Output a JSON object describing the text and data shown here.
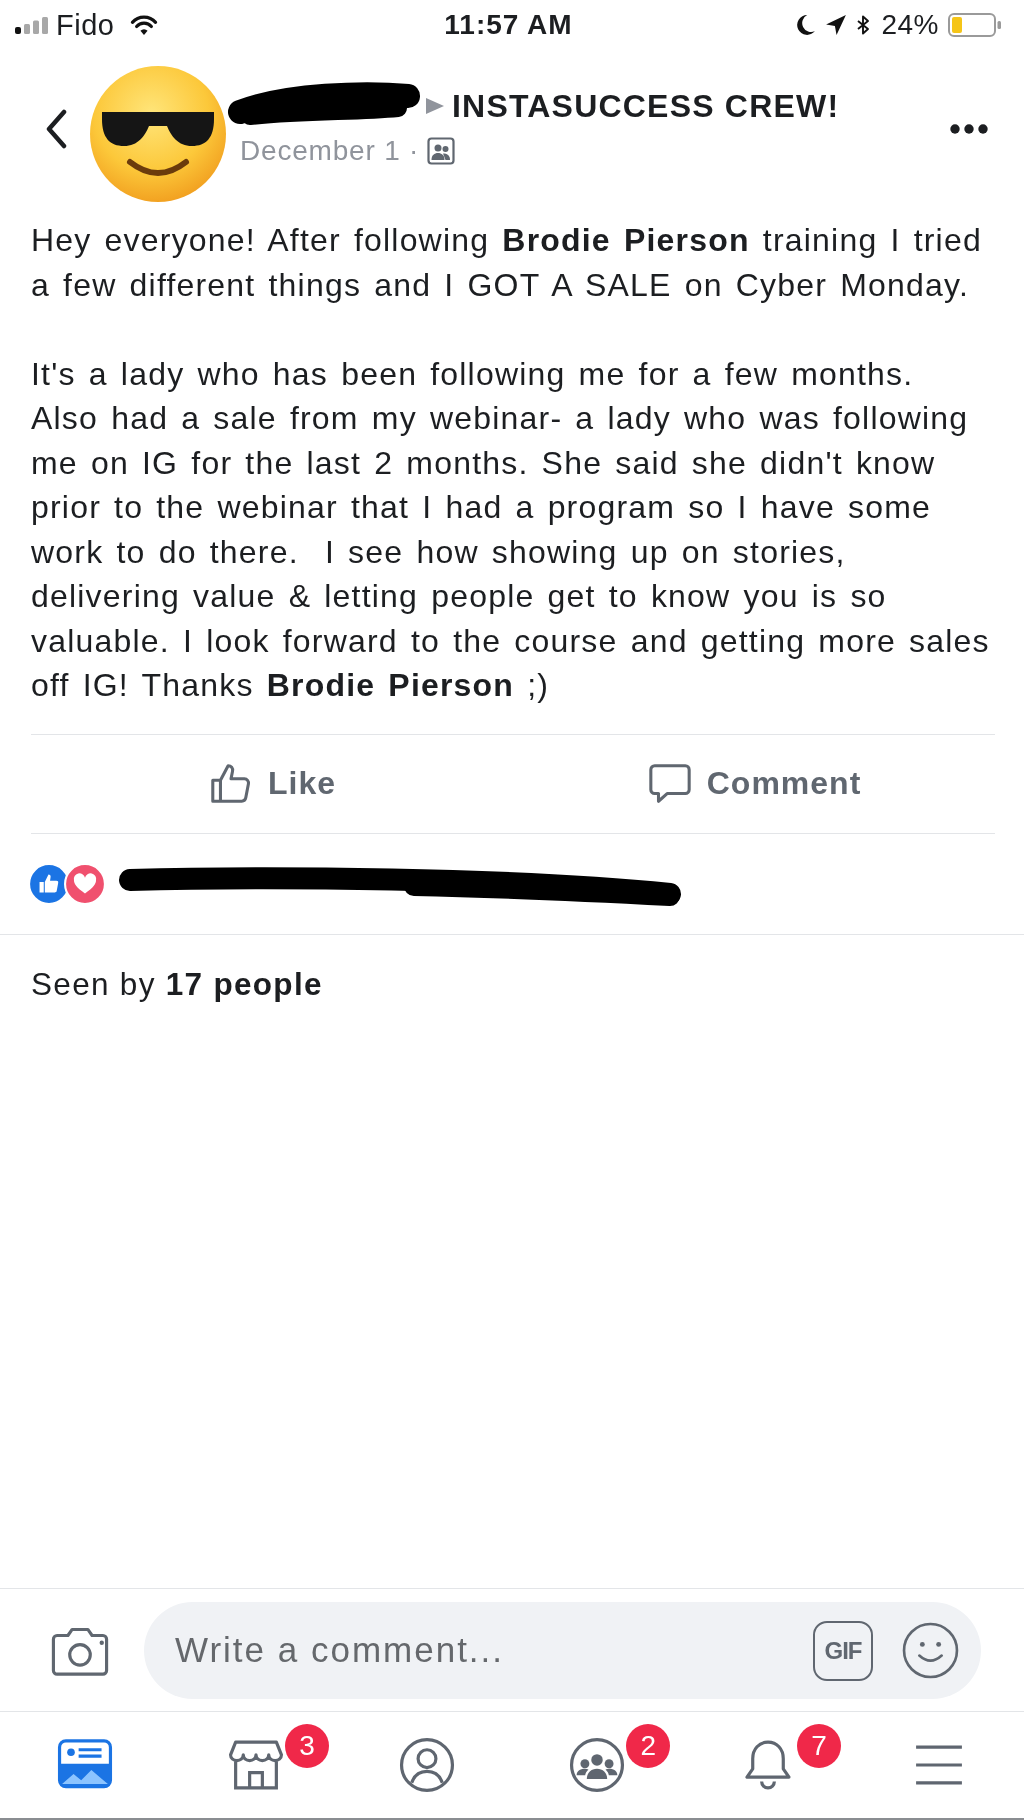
{
  "status_bar": {
    "carrier": "Fido",
    "time": "11:57 AM",
    "battery": "24%"
  },
  "header": {
    "group_name": "INSTASUCCESS CREW!",
    "date": "December 1 ·"
  },
  "post": {
    "paragraphs": [
      "Hey everyone! After following **Brodie Pierson** training I tried a few different things and I GOT A SALE on Cyber Monday.",
      "It's a lady who has been following me for a few months.\nAlso had a sale from my webinar- a lady who was following me on IG for the last 2 months. She said she didn't know prior to the webinar that I had a program so I have some work to do there.  I see how showing up on stories, delivering value & letting people get to know you is so valuable. I look forward to the course and getting more sales off IG! Thanks **Brodie Pierson** ;)"
    ]
  },
  "actions": [
    {
      "kind": "like",
      "label": "Like"
    },
    {
      "kind": "comment",
      "label": "Comment"
    }
  ],
  "seen_by": "Seen by **17 people**",
  "comment_bar": {
    "placeholder": "Write a comment...",
    "gif_label": "GIF"
  },
  "tab_bar": [
    {
      "kind": "news_feed",
      "selected": true
    },
    {
      "kind": "marketplace",
      "selected": false,
      "badge": "3"
    },
    {
      "kind": "profile",
      "selected": false
    },
    {
      "kind": "groups",
      "selected": false,
      "badge": "2"
    },
    {
      "kind": "notifications",
      "selected": false,
      "badge": "7"
    },
    {
      "kind": "menu",
      "selected": false
    }
  ]
}
